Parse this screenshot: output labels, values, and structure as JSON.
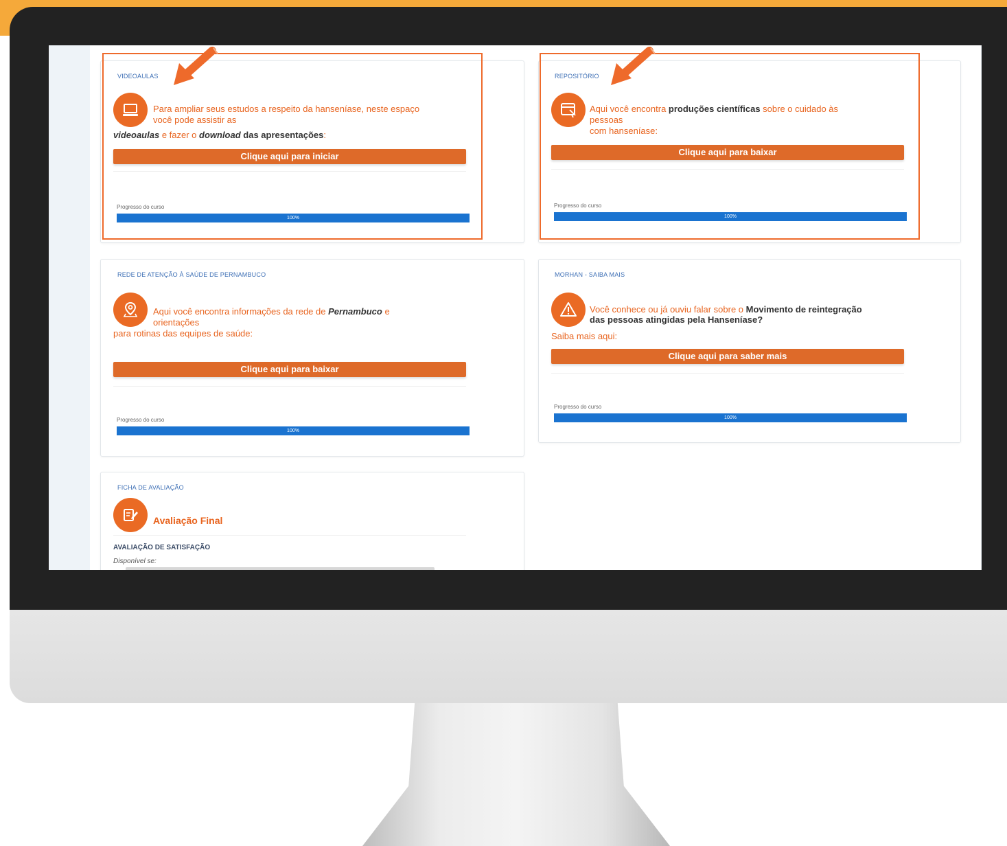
{
  "cards": {
    "videoaulas": {
      "title": "VIDEOAULAS",
      "line1": "Para ampliar seus estudos a respeito da hanseníase, neste espaço",
      "line2": "você pode assistir as",
      "line3_em1": "videoaulas",
      "line3_mid": " e fazer o ",
      "line3_em2": "download",
      "line3_end": " das apresentações",
      "line3_colon": ":",
      "button": "Clique aqui para iniciar",
      "progress_label": "Progresso do curso",
      "progress_value": "100%",
      "progress_fraction": 1.0
    },
    "repositorio": {
      "title": "REPOSITÓRIO",
      "line1_a": "Aqui você encontra ",
      "line1_b": "produções científicas",
      "line1_c": " sobre o cuidado às",
      "line2": "pessoas",
      "line3": "com hanseníase:",
      "button": "Clique aqui para baixar",
      "progress_label": "Progresso do curso",
      "progress_value": "100%",
      "progress_fraction": 1.0
    },
    "rede": {
      "title": "REDE DE ATENÇÃO À SAÚDE DE PERNAMBUCO",
      "line1_a": "Aqui você encontra informações da rede de ",
      "line1_b": "Pernambuco",
      "line1_c": " e",
      "line2": "orientações",
      "line3": "para rotinas das equipes de saúde:",
      "button": "Clique aqui para baixar",
      "progress_label": "Progresso do curso",
      "progress_value": "100%",
      "progress_fraction": 1.0
    },
    "morhan": {
      "title": "MORHAN - SAIBA MAIS",
      "line1_a": "Você conhece ou já ouviu falar sobre o  ",
      "line1_b": "Movimento de reintegração",
      "line2": "das pessoas atingidas pela Hanseníase?",
      "line3": "Saiba mais aqui:",
      "button": "Clique aqui para saber mais",
      "progress_label": "Progresso do curso",
      "progress_value": "100%",
      "progress_fraction": 1.0
    },
    "ficha": {
      "title": "FICHA DE AVALIAÇÃO",
      "heading": "Avaliação Final",
      "subheading": "AVALIAÇÃO DE SATISFAÇÃO",
      "availability": "Disponível se:"
    }
  },
  "icons": {
    "videoaulas": "laptop-icon",
    "repositorio": "window-cursor-icon",
    "rede": "map-pin-icon",
    "morhan": "warning-icon",
    "ficha": "edit-document-icon"
  },
  "colors": {
    "accent_orange": "#de6a29",
    "progress_blue": "#1a73d0",
    "title_blue": "#3d6fb5",
    "highlight_orange": "#ee6a2b"
  }
}
